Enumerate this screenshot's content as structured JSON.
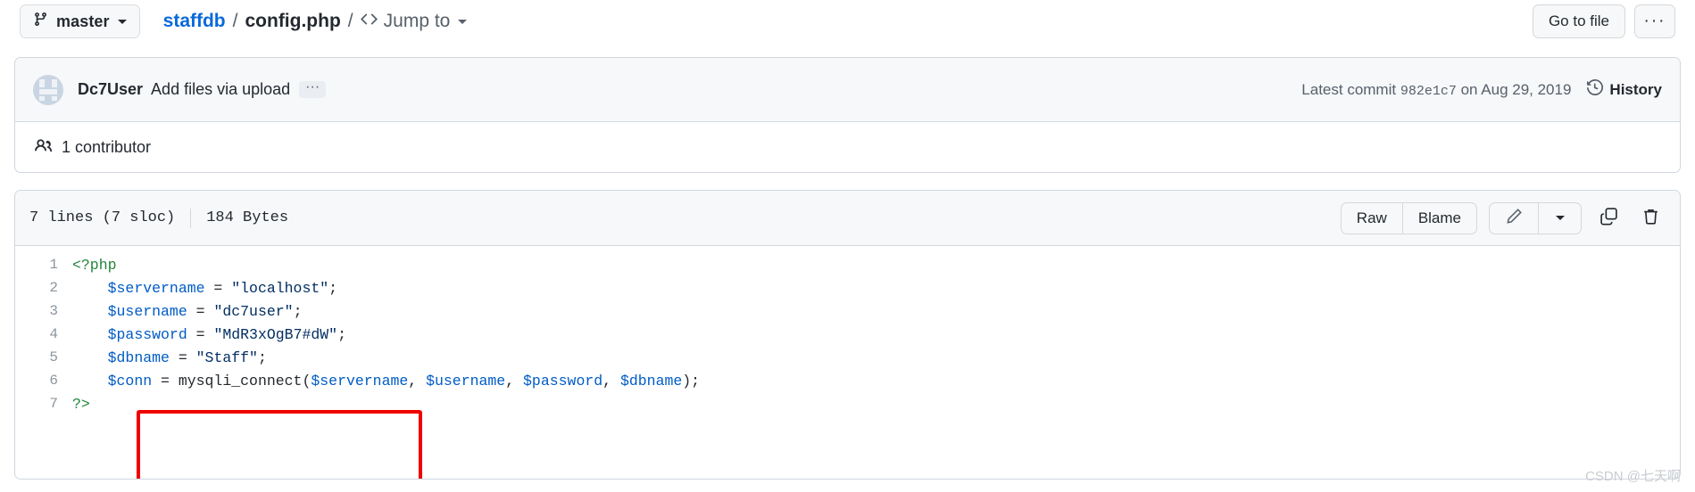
{
  "header": {
    "branch": {
      "label": "master",
      "icon": "branch-icon"
    },
    "breadcrumb": {
      "repo": "staffdb",
      "separator": "/",
      "file": "config.php",
      "separator2": "/"
    },
    "jump_to": {
      "label": "Jump to",
      "icon": "code-brackets-icon"
    },
    "go_to_file_label": "Go to file",
    "kebab_label": "···"
  },
  "commit": {
    "author": "Dc7User",
    "message": "Add files via upload",
    "ellipsis_label": "···",
    "latest_prefix": "Latest commit",
    "sha": "982e1c7",
    "date_text": "on Aug 29, 2019",
    "history_label": "History",
    "history_icon": "history-clock-icon"
  },
  "contributors": {
    "icon": "people-icon",
    "count": "1",
    "label": "contributor",
    "text": "1 contributor"
  },
  "file": {
    "lines_text": "7 lines (7 sloc)",
    "size_text": "184 Bytes",
    "actions": {
      "raw": "Raw",
      "blame": "Blame",
      "edit_icon": "pencil-icon",
      "edit_dropdown_icon": "chevron-down-icon",
      "copy_icon": "copy-icon",
      "delete_icon": "trash-icon"
    }
  },
  "code": {
    "language": "php",
    "lines": [
      {
        "number": "1",
        "tokens": [
          {
            "t": "<?php",
            "c": "tok-tag"
          }
        ]
      },
      {
        "number": "2",
        "tokens": [
          {
            "t": "    ",
            "c": "tok-op"
          },
          {
            "t": "$servername",
            "c": "tok-var"
          },
          {
            "t": " = ",
            "c": "tok-op"
          },
          {
            "t": "\"localhost\"",
            "c": "tok-str"
          },
          {
            "t": ";",
            "c": "tok-op"
          }
        ]
      },
      {
        "number": "3",
        "tokens": [
          {
            "t": "    ",
            "c": "tok-op"
          },
          {
            "t": "$username",
            "c": "tok-var"
          },
          {
            "t": " = ",
            "c": "tok-op"
          },
          {
            "t": "\"dc7user\"",
            "c": "tok-str"
          },
          {
            "t": ";",
            "c": "tok-op"
          }
        ]
      },
      {
        "number": "4",
        "tokens": [
          {
            "t": "    ",
            "c": "tok-op"
          },
          {
            "t": "$password",
            "c": "tok-var"
          },
          {
            "t": " = ",
            "c": "tok-op"
          },
          {
            "t": "\"MdR3xOgB7#dW\"",
            "c": "tok-str"
          },
          {
            "t": ";",
            "c": "tok-op"
          }
        ]
      },
      {
        "number": "5",
        "tokens": [
          {
            "t": "    ",
            "c": "tok-op"
          },
          {
            "t": "$dbname",
            "c": "tok-var"
          },
          {
            "t": " = ",
            "c": "tok-op"
          },
          {
            "t": "\"Staff\"",
            "c": "tok-str"
          },
          {
            "t": ";",
            "c": "tok-op"
          }
        ]
      },
      {
        "number": "6",
        "tokens": [
          {
            "t": "    ",
            "c": "tok-op"
          },
          {
            "t": "$conn",
            "c": "tok-var"
          },
          {
            "t": " = mysqli_connect(",
            "c": "tok-op"
          },
          {
            "t": "$servername",
            "c": "tok-var"
          },
          {
            "t": ", ",
            "c": "tok-op"
          },
          {
            "t": "$username",
            "c": "tok-var"
          },
          {
            "t": ", ",
            "c": "tok-op"
          },
          {
            "t": "$password",
            "c": "tok-var"
          },
          {
            "t": ", ",
            "c": "tok-op"
          },
          {
            "t": "$dbname",
            "c": "tok-var"
          },
          {
            "t": ");",
            "c": "tok-op"
          }
        ]
      },
      {
        "number": "7",
        "tokens": [
          {
            "t": "?>",
            "c": "tok-tag"
          }
        ]
      }
    ]
  },
  "annotation": {
    "type": "red-rectangle",
    "color": "#f00000"
  },
  "watermark": {
    "text": "CSDN @七天啊"
  },
  "colors": {
    "link": "#0969da",
    "text": "#24292f",
    "muted": "#57606a",
    "border": "#d0d7de",
    "surface": "#f6f8fa",
    "string": "#032f62",
    "variable": "#005cc5",
    "tag": "#22863a",
    "annotation": "#f00000"
  }
}
